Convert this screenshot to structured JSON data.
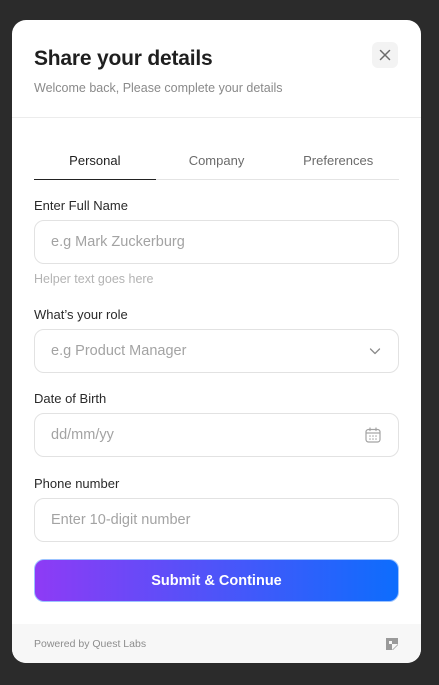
{
  "header": {
    "title": "Share your details",
    "subtitle": "Welcome back, Please complete your details",
    "close_icon": "close-icon"
  },
  "tabs": [
    {
      "label": "Personal",
      "active": true
    },
    {
      "label": "Company",
      "active": false
    },
    {
      "label": "Preferences",
      "active": false
    }
  ],
  "form": {
    "full_name": {
      "label": "Enter Full Name",
      "placeholder": "e.g Mark Zuckerburg",
      "value": "",
      "helper": "Helper text goes here"
    },
    "role": {
      "label": "What’s your role",
      "placeholder": "e.g Product Manager",
      "icon": "chevron-down-icon"
    },
    "dob": {
      "label": "Date of Birth",
      "placeholder": "dd/mm/yy",
      "icon": "calendar-icon"
    },
    "phone": {
      "label": "Phone number",
      "placeholder": "Enter 10-digit number",
      "value": ""
    }
  },
  "submit": {
    "label": "Submit & Continue",
    "gradient_start": "#8e3bf5",
    "gradient_end": "#0d6dfd"
  },
  "footer": {
    "text": "Powered by Quest Labs",
    "logo": "quest-logo-icon"
  }
}
